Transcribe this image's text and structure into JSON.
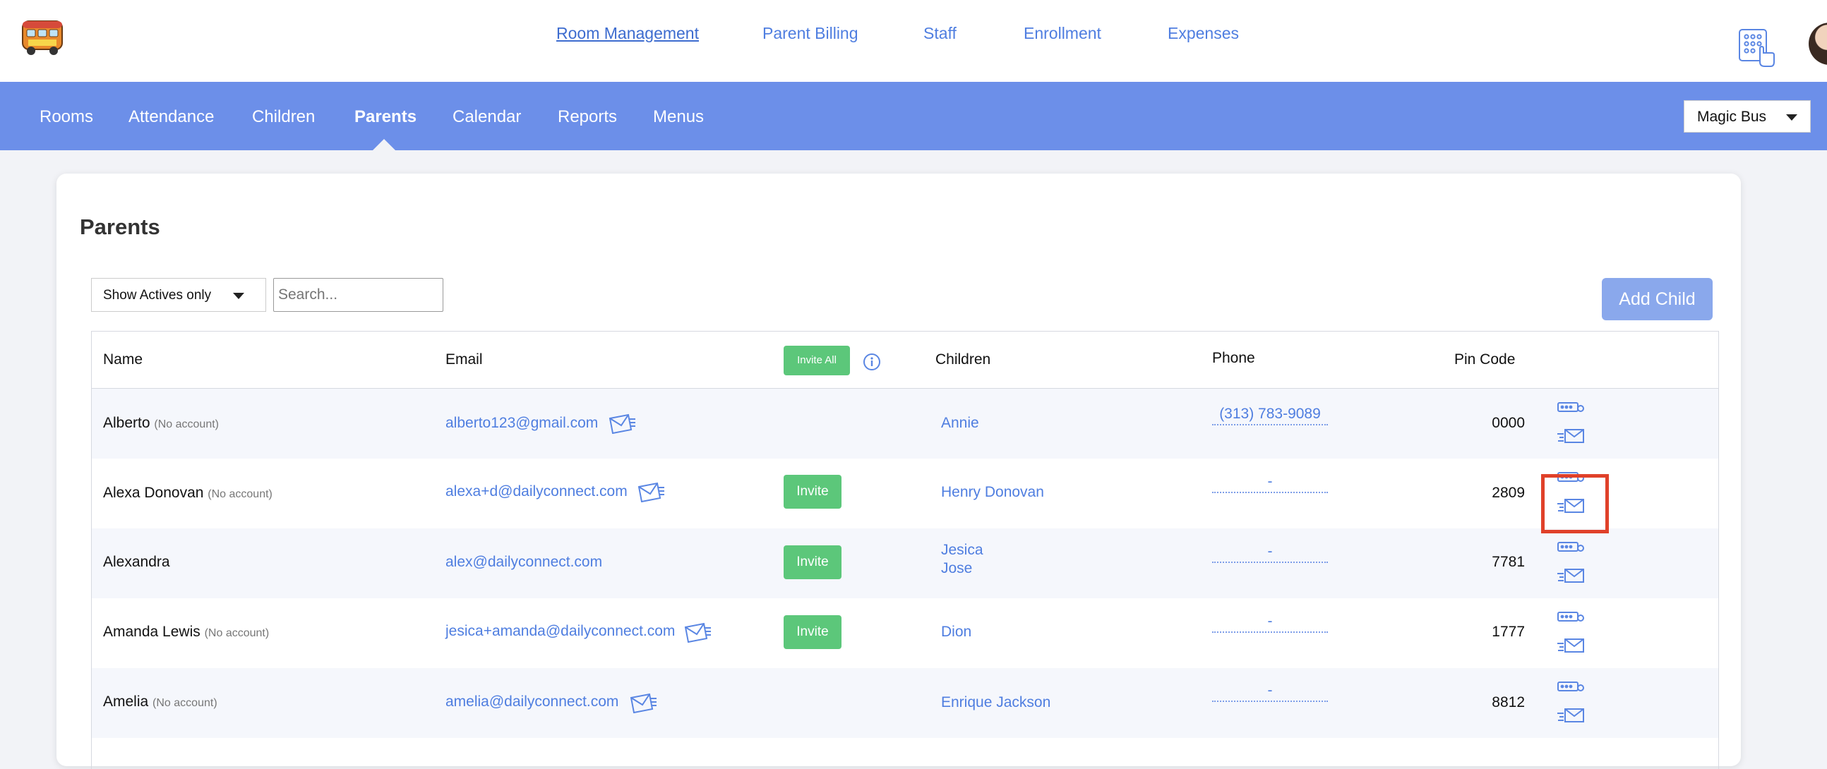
{
  "app": {
    "logo_label": "MAGIC BUS",
    "top_nav": [
      "Room Management",
      "Parent Billing",
      "Staff",
      "Enrollment",
      "Expenses"
    ],
    "active_top_nav": "Room Management",
    "main_nav": [
      "Rooms",
      "Attendance",
      "Children",
      "Parents",
      "Calendar",
      "Reports",
      "Menus"
    ],
    "active_main_nav": "Parents",
    "org_selector": "Magic Bus",
    "accent_color": "#6c8fe9",
    "link_color": "#4f7ee0",
    "invite_color": "#5cc77a",
    "highlight_color": "#e0412a"
  },
  "page": {
    "title": "Parents",
    "filter_value": "Show Actives only",
    "search_placeholder": "Search...",
    "add_child_label": "Add Child"
  },
  "table": {
    "headers": {
      "name": "Name",
      "email": "Email",
      "invite_all": "Invite All",
      "children": "Children",
      "phone": "Phone",
      "pin": "Pin Code"
    },
    "rows": [
      {
        "name": "Alberto",
        "note": "(No account)",
        "email": "alberto123@gmail.com",
        "invite": "",
        "children": [
          "Annie"
        ],
        "phone": "(313) 783-9089",
        "pin": "0000"
      },
      {
        "name": "Alexa Donovan",
        "note": "(No account)",
        "email": "alexa+d@dailyconnect.com",
        "invite": "Invite",
        "children": [
          "Henry Donovan"
        ],
        "phone": "-",
        "pin": "2809"
      },
      {
        "name": "Alexandra",
        "note": "",
        "email": "alex@dailyconnect.com",
        "invite": "Invite",
        "children": [
          "Jesica",
          "Jose"
        ],
        "phone": "-",
        "pin": "7781"
      },
      {
        "name": "Amanda Lewis",
        "note": "(No account)",
        "email": "jesica+amanda@dailyconnect.com",
        "invite": "Invite",
        "children": [
          "Dion"
        ],
        "phone": "-",
        "pin": "1777"
      },
      {
        "name": "Amelia",
        "note": "(No account)",
        "email": "amelia@dailyconnect.com",
        "invite": "",
        "children": [
          "Enrique Jackson"
        ],
        "phone": "-",
        "pin": "8812"
      }
    ]
  },
  "icons": {
    "send_mail": "mail-send-icon",
    "pin_send": "pin-send-icon",
    "keypad": "keypad-icon",
    "info": "info-icon"
  }
}
